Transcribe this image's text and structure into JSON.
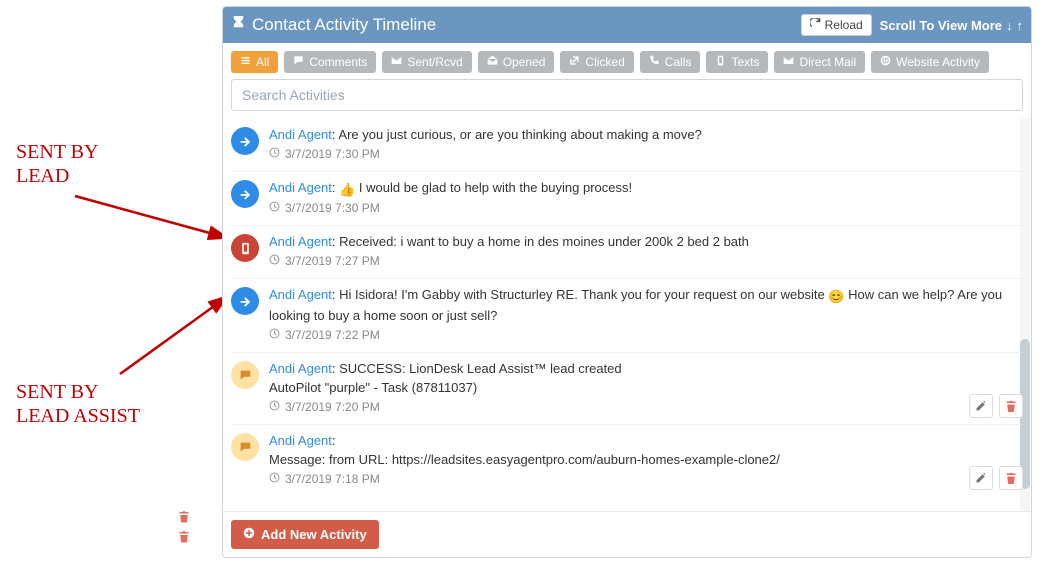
{
  "header": {
    "title": "Contact Activity Timeline",
    "reload": "Reload",
    "scroll_hint": "Scroll To View More"
  },
  "filters": {
    "all": "All",
    "comments": "Comments",
    "sentrcvd": "Sent/Rcvd",
    "opened": "Opened",
    "clicked": "Clicked",
    "calls": "Calls",
    "texts": "Texts",
    "directmail": "Direct Mail",
    "website": "Website Activity"
  },
  "search": {
    "placeholder": "Search Activities"
  },
  "activities": [
    {
      "agent": "Andi Agent",
      "text": ": Are you just curious, or are you thinking about making a move?",
      "time": "3/7/2019 7:30 PM",
      "icon": "blue-arrow"
    },
    {
      "agent": "Andi Agent",
      "prefix": ": ",
      "emoji": "👍",
      "text": " I would be glad to help with the buying process!",
      "time": "3/7/2019 7:30 PM",
      "icon": "blue-arrow"
    },
    {
      "agent": "Andi Agent",
      "text": ": Received: i want to buy a home in des moines under 200k 2 bed 2 bath",
      "time": "3/7/2019 7:27 PM",
      "icon": "red-phone"
    },
    {
      "agent": "Andi Agent",
      "prefix": ": Hi Isidora! I'm Gabby with Structurley RE. Thank you for your request on our website ",
      "emoji": "😊",
      "text": " How can we help? Are you looking to buy a home soon or just sell?",
      "time": "3/7/2019 7:22 PM",
      "icon": "blue-arrow"
    },
    {
      "agent": "Andi Agent",
      "text": ": SUCCESS: LionDesk Lead Assist™ lead created",
      "extra": "AutoPilot \"purple\" - Task (87811037)",
      "time": "3/7/2019 7:20 PM",
      "icon": "tan-comment",
      "actions": true
    },
    {
      "agent": "Andi Agent",
      "text": ":",
      "extra": "Message: from URL: https://leadsites.easyagentpro.com/auburn-homes-example-clone2/",
      "time": "3/7/2019 7:18 PM",
      "icon": "tan-comment",
      "actions": true
    }
  ],
  "footer": {
    "add": "Add New Activity"
  },
  "annotations": {
    "lead": "SENT BY\nLEAD",
    "assist": "SENT BY\nLEAD ASSIST"
  }
}
